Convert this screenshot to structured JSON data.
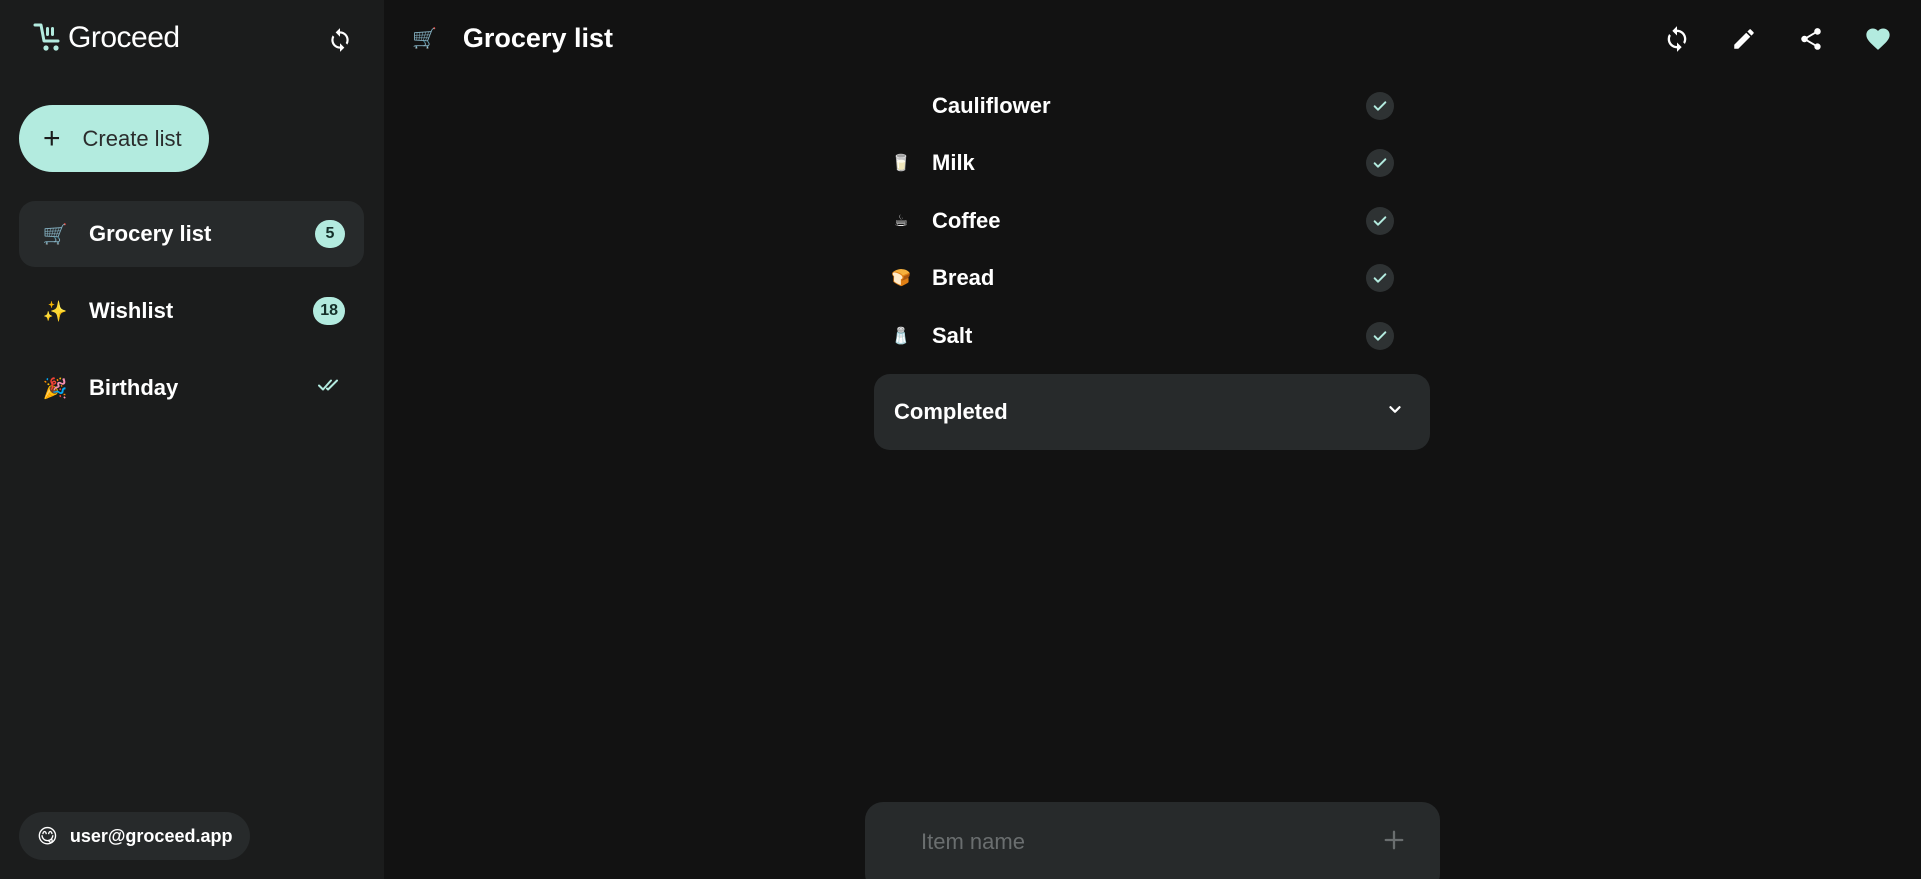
{
  "app": {
    "name": "Groceed"
  },
  "colors": {
    "accent": "#b3ebdf",
    "sidebar_bg": "#1b1c1c",
    "main_bg": "#121212",
    "panel_bg": "#272a2b"
  },
  "sidebar": {
    "create_label": "Create list",
    "lists": [
      {
        "icon": "shopping-cart",
        "emoji": "🛒",
        "label": "Grocery list",
        "count": "5",
        "active": true
      },
      {
        "icon": "sparkles",
        "emoji": "✨",
        "label": "Wishlist",
        "count": "18",
        "active": false
      },
      {
        "icon": "party-popper",
        "emoji": "🎉",
        "label": "Birthday",
        "status": "done-all",
        "active": false
      }
    ],
    "user": {
      "emoji": "😋",
      "email": "user@groceed.app"
    }
  },
  "header": {
    "title": "Grocery list",
    "emoji": "🛒",
    "actions": [
      "sync",
      "edit",
      "share",
      "favorite"
    ]
  },
  "items": [
    {
      "label": "Cauliflower",
      "emoji": ""
    },
    {
      "label": "Milk",
      "emoji": "🥛"
    },
    {
      "label": "Coffee",
      "emoji": "☕"
    },
    {
      "label": "Bread",
      "emoji": "🍞"
    },
    {
      "label": "Salt",
      "emoji": "🧂"
    }
  ],
  "completed": {
    "label": "Completed"
  },
  "add_item": {
    "placeholder": "Item name"
  }
}
